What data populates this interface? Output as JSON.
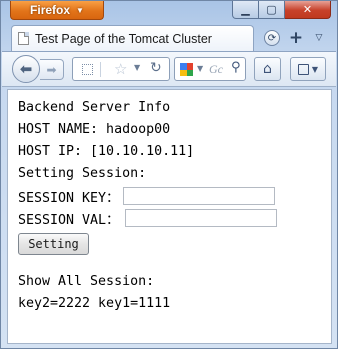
{
  "browser": {
    "menu_button_label": "Firefox",
    "tab_title": "Test Page of the Tomcat Cluster",
    "new_tab_symbol": "+",
    "search_placeholder": "Gc"
  },
  "page": {
    "heading": "Backend Server Info",
    "host_name_line": "HOST NAME: hadoop00",
    "host_ip_line": "HOST IP: [10.10.10.11]",
    "setting_session_label": "Setting Session:",
    "session_key_label": "SESSION KEY：",
    "session_key_value": "",
    "session_val_label": "SESSION VAL：",
    "session_val_value": "",
    "setting_button_label": "Setting",
    "show_session_label": "Show All Session:",
    "sessions_line": "key2=2222 key1=1111"
  }
}
